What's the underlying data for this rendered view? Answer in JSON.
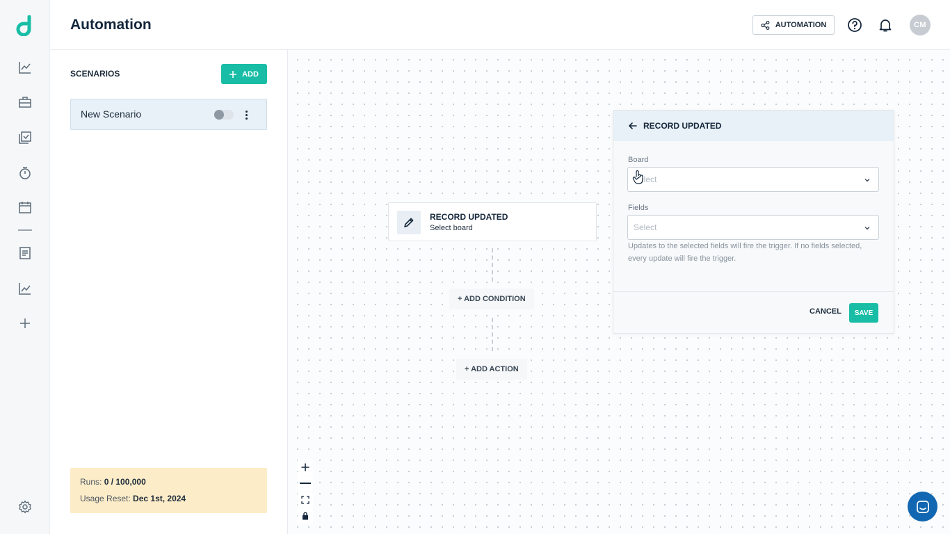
{
  "header": {
    "title": "Automation",
    "automation_button": "AUTOMATION",
    "avatar_initials": "CM"
  },
  "rail": {
    "items": [
      "analytics-icon",
      "briefcase-icon",
      "tasks-icon",
      "timer-icon",
      "calendar-icon",
      "document-icon",
      "reports-icon",
      "plus-icon"
    ],
    "bottom": "settings-icon"
  },
  "scenarios": {
    "title": "SCENARIOS",
    "add_label": "ADD",
    "items": [
      {
        "name": "New Scenario",
        "enabled": false
      }
    ],
    "usage": {
      "runs_label": "Runs:",
      "runs_value": "0 / 100,000",
      "reset_label": "Usage Reset:",
      "reset_value": "Dec 1st, 2024"
    }
  },
  "canvas": {
    "trigger": {
      "title": "RECORD UPDATED",
      "subtitle": "Select board"
    },
    "add_condition": "+ ADD CONDITION",
    "add_action": "+ ADD ACTION"
  },
  "config": {
    "title": "RECORD UPDATED",
    "board_label": "Board",
    "board_placeholder": "Select",
    "fields_label": "Fields",
    "fields_placeholder": "Select",
    "hint": "Updates to the selected fields will fire the trigger. If no fields selected, every update will fire the trigger.",
    "cancel": "CANCEL",
    "save": "SAVE"
  },
  "colors": {
    "accent": "#19bda6",
    "chat": "#1167b1",
    "usage_bg": "#fdecc8"
  }
}
